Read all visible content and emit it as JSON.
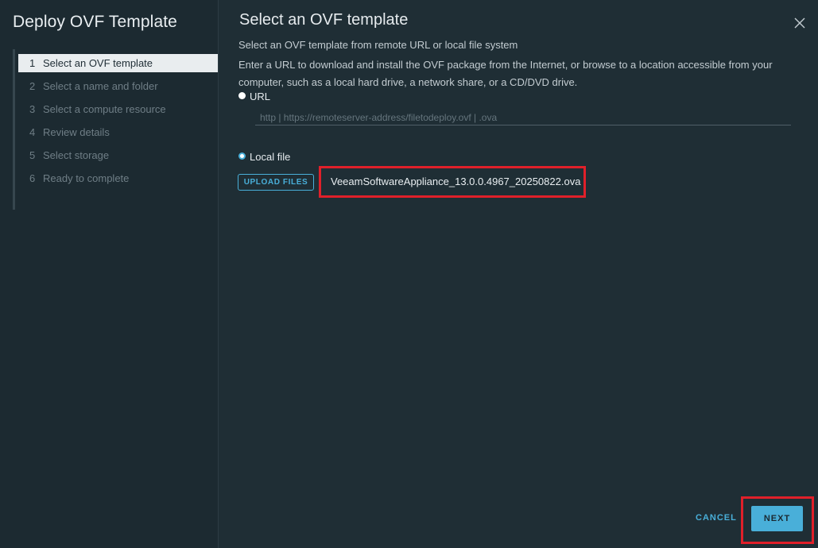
{
  "wizard": {
    "title": "Deploy OVF Template",
    "steps": [
      {
        "num": "1",
        "label": "Select an OVF template",
        "active": true
      },
      {
        "num": "2",
        "label": "Select a name and folder",
        "active": false
      },
      {
        "num": "3",
        "label": "Select a compute resource",
        "active": false
      },
      {
        "num": "4",
        "label": "Review details",
        "active": false
      },
      {
        "num": "5",
        "label": "Select storage",
        "active": false
      },
      {
        "num": "6",
        "label": "Ready to complete",
        "active": false
      }
    ]
  },
  "main": {
    "title": "Select an OVF template",
    "description_1": "Select an OVF template from remote URL or local file system",
    "description_2": "Enter a URL to download and install the OVF package from the Internet, or browse to a location accessible from your computer, such as a local hard drive, a network share, or a CD/DVD drive.",
    "url_option_label": "URL",
    "url_value": "",
    "url_placeholder": "http | https://remoteserver-address/filetodeploy.ovf | .ova",
    "local_option_label": "Local file",
    "selected_source": "local",
    "upload_button_label": "UPLOAD FILES",
    "selected_file": "VeeamSoftwareAppliance_13.0.0.4967_20250822.ova"
  },
  "footer": {
    "cancel_label": "CANCEL",
    "next_label": "NEXT"
  },
  "colors": {
    "accent": "#49afd9",
    "highlight": "#e0202a",
    "background": "#1f2e35"
  },
  "icons": {
    "close": "close-icon"
  }
}
